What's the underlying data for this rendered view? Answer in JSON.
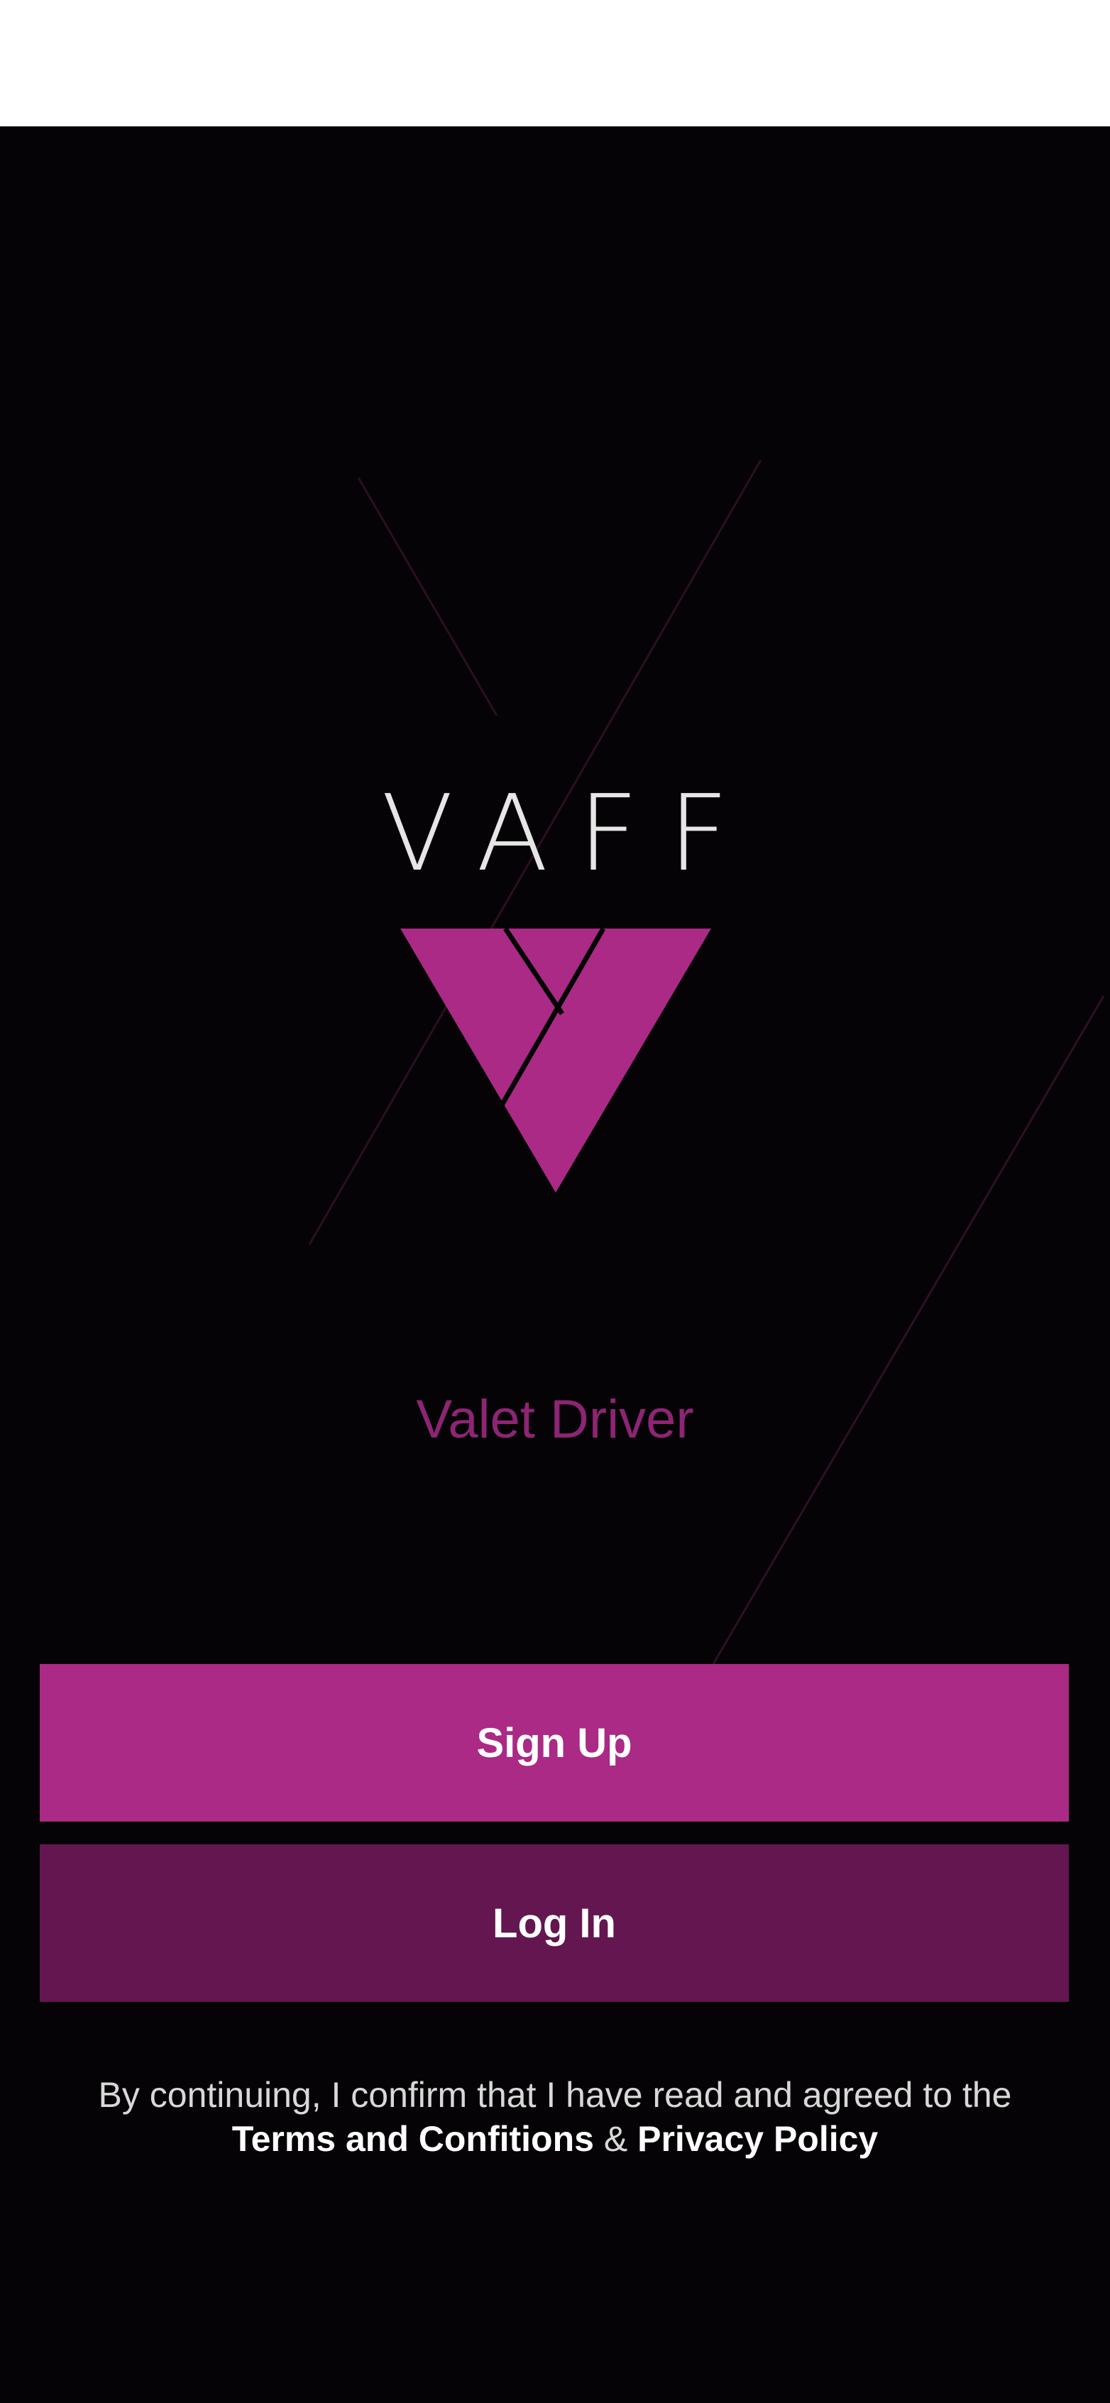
{
  "brand": {
    "wordmark": "VAFF",
    "subtitle": "Valet Driver"
  },
  "actions": {
    "signup_label": "Sign Up",
    "login_label": "Log In"
  },
  "legal": {
    "prefix": "By continuing, I confirm that I have read and agreed to the",
    "terms_link": "Terms and Confitions",
    "ampersand": "&",
    "privacy_link": "Privacy Policy"
  },
  "colors": {
    "background": "#050305",
    "accent": "#aa2a85",
    "accent_dark": "#63164f",
    "subtitle": "#8e2474",
    "status_area": "#ffffff"
  },
  "icons": {
    "logo": "vaff-v-triangle-logo"
  }
}
